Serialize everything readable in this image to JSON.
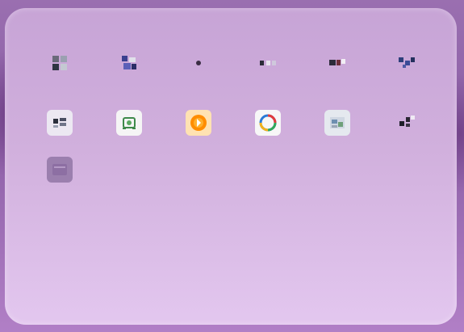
{
  "launcher": {
    "apps": [
      {
        "id": "app-1",
        "icon": "grid-app-icon"
      },
      {
        "id": "app-2",
        "icon": "blocks-app-icon"
      },
      {
        "id": "app-3",
        "icon": "dot-app-icon"
      },
      {
        "id": "app-4",
        "icon": "dots-app-icon"
      },
      {
        "id": "app-5",
        "icon": "media-app-icon"
      },
      {
        "id": "app-6",
        "icon": "network-app-icon"
      },
      {
        "id": "app-7",
        "icon": "window-app-icon"
      },
      {
        "id": "app-8",
        "icon": "camera-app-icon"
      },
      {
        "id": "app-9",
        "icon": "orange-circle-app-icon"
      },
      {
        "id": "app-10",
        "icon": "color-ring-app-icon"
      },
      {
        "id": "app-11",
        "icon": "photo-app-icon"
      },
      {
        "id": "app-12",
        "icon": "dark-app-icon"
      },
      {
        "id": "app-13",
        "icon": "folder-app-icon"
      }
    ]
  }
}
